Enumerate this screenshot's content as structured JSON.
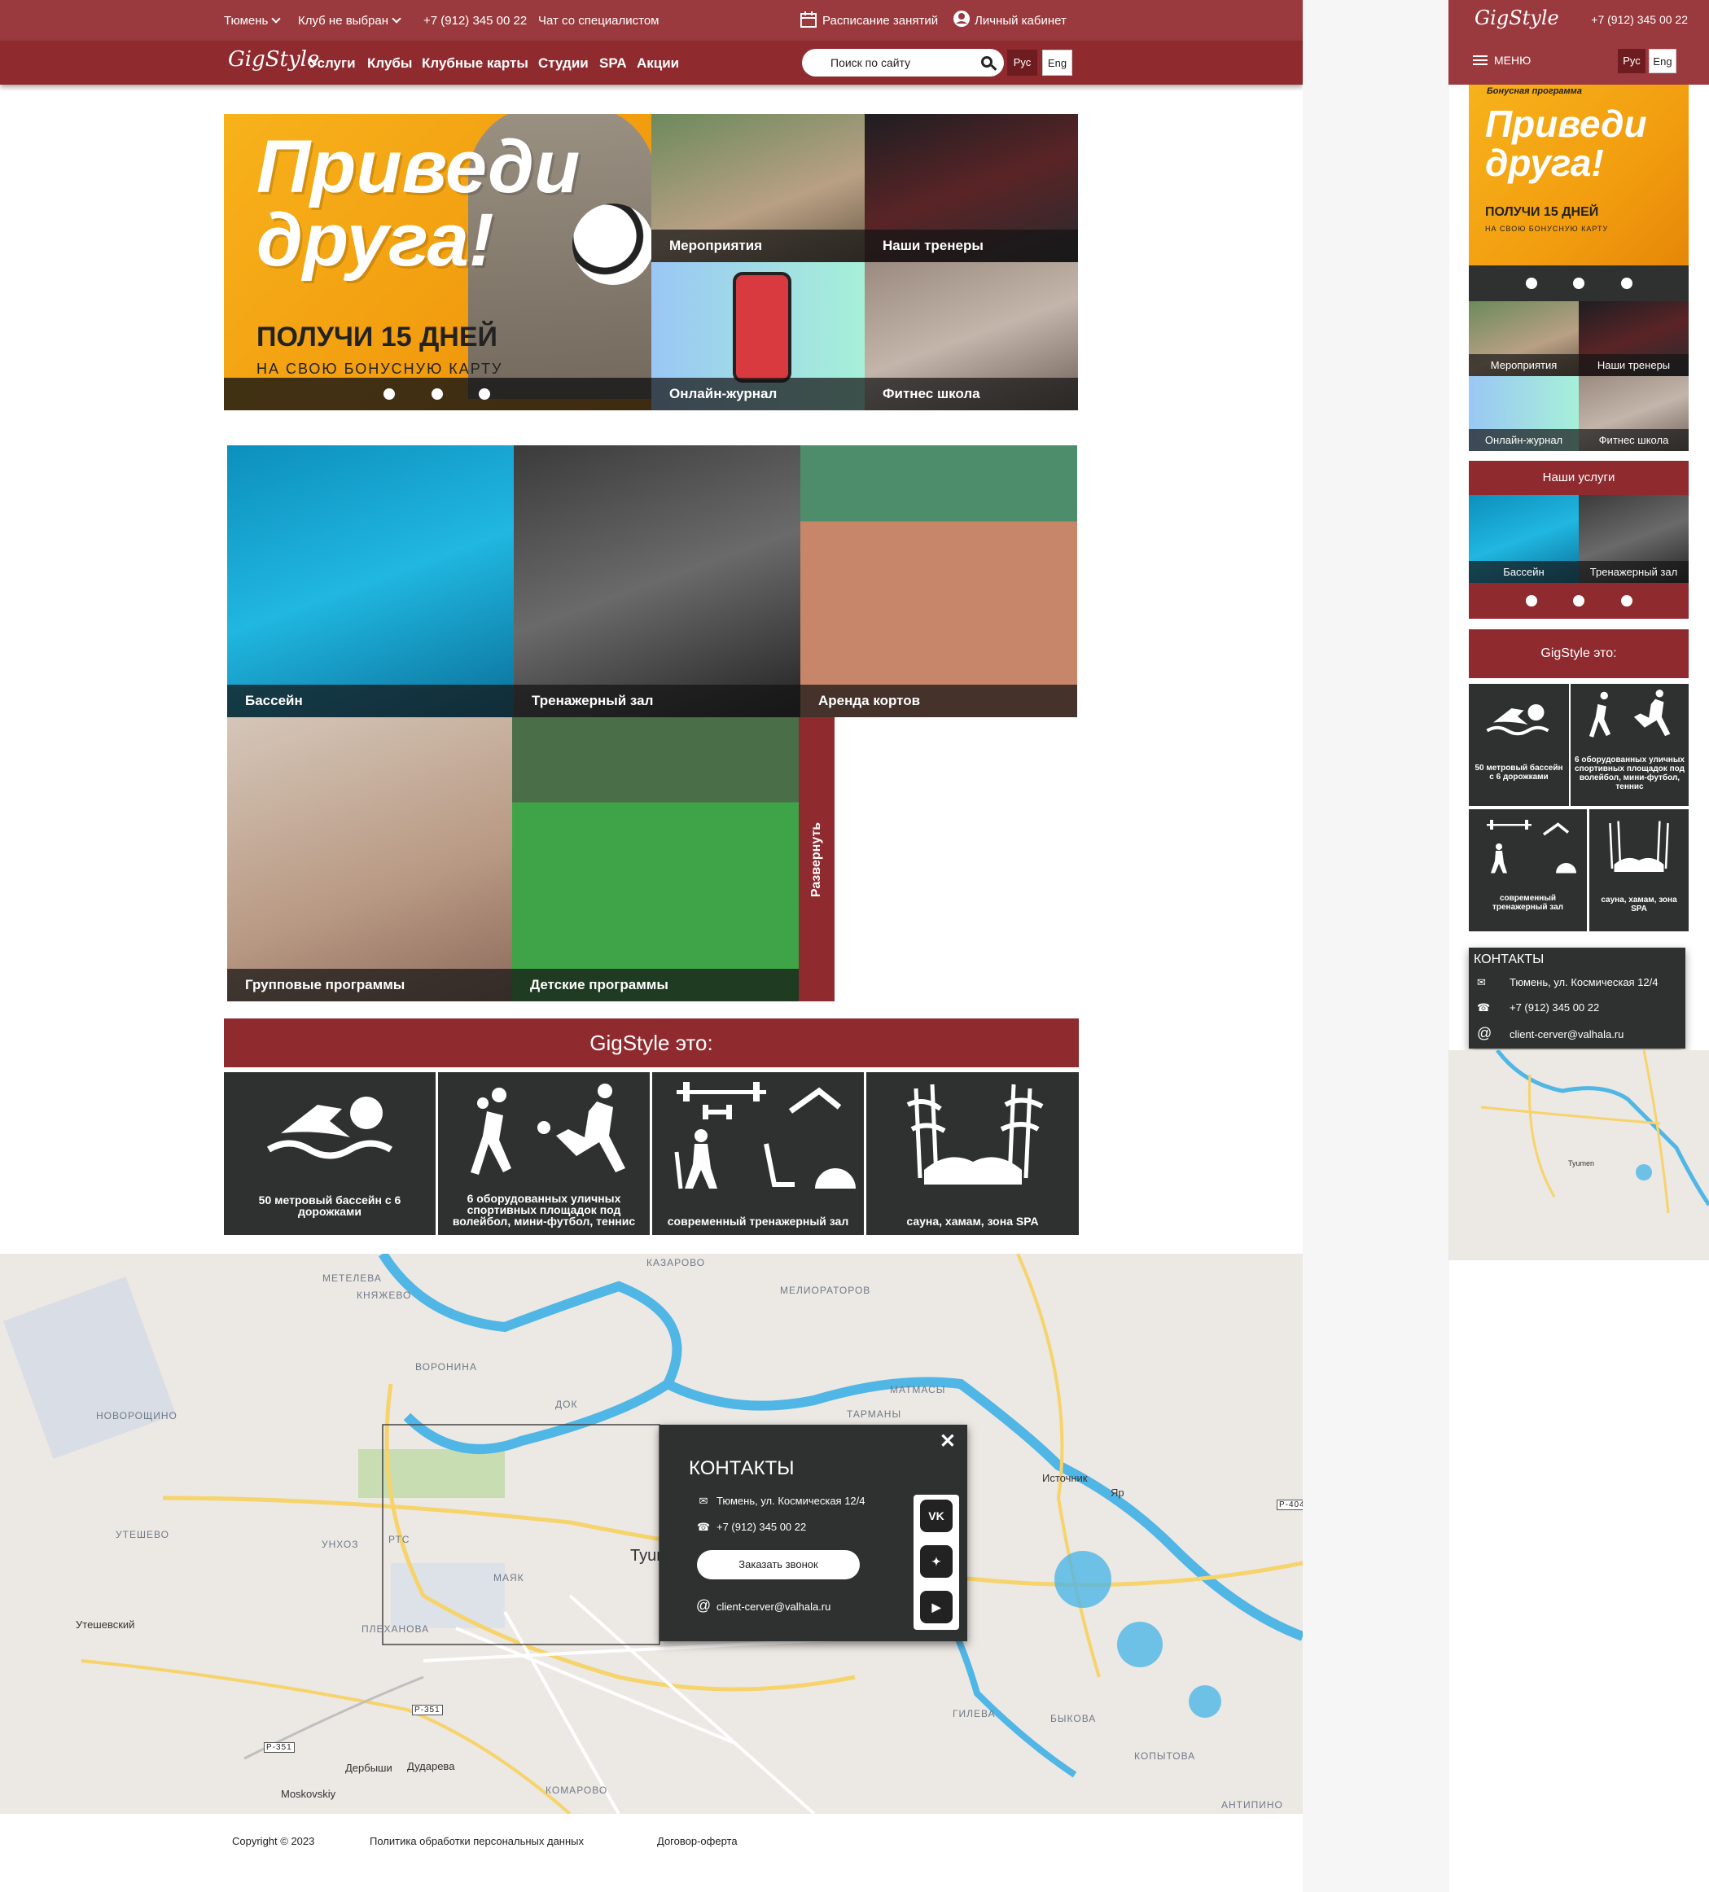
{
  "header": {
    "city": "Тюмень",
    "club": "Клуб не выбран",
    "phone": "+7 (912) 345 00 22",
    "chat": "Чат со специалистом",
    "schedule": "Расписание занятий",
    "cabinet": "Личный кабинет"
  },
  "nav": {
    "logo": "GigStyle",
    "items": [
      "Услуги",
      "Клубы",
      "Клубные карты",
      "Студии",
      "SPA",
      "Акции"
    ],
    "search_placeholder": "Поиск по сайту",
    "lang_ru": "Рус",
    "lang_en": "Eng"
  },
  "hero": {
    "promo_title_1": "Приведи",
    "promo_title_2": "друга!",
    "promo_sub": "ПОЛУЧИ 15 ДНЕЙ",
    "promo_sub2": "НА СВОЮ БОНУСНУЮ КАРТУ",
    "tiles": [
      "Мероприятия",
      "Наши тренеры",
      "Онлайн-журнал",
      "Фитнес школа"
    ]
  },
  "services": {
    "tiles": [
      "Бассейн",
      "Тренажерный зал",
      "Аренда кортов",
      "Групповые программы",
      "Детские программы"
    ],
    "expand": "Развернуть"
  },
  "about": {
    "title": "GigStyle это:",
    "features": [
      "50 метровый бассейн с 6 дорожками",
      "6 оборудованных уличных спортивных площадок под волейбол, мини-футбол, теннис",
      "современный тренажерный зал",
      "сауна, хамам, зона SPA"
    ],
    "icons": [
      "swimmer-icon",
      "volleyball-football-icon",
      "gym-equipment-icon",
      "sauna-bamboo-icon"
    ]
  },
  "map": {
    "labels": [
      "КАЗАРОВО",
      "МЕТЕЛЕВА",
      "КНЯЖЕВО",
      "МЕЛИОРАТОРОВ",
      "ВОРОНИНА",
      "НОВОРОЩИНО",
      "МАТМАСЫ",
      "ДОК",
      "ТАРМАНЫ",
      "УТЕШЕВО",
      "РТС",
      "УНХОЗ",
      "МАЯК",
      "ПЛЕХАНОВА",
      "ГИЛЕВА",
      "БЫКОВА",
      "КОПЫТОВА",
      "КОМАРОВО",
      "АНТИПИНО"
    ],
    "cities": [
      "Tyumen",
      "Источник",
      "Яр",
      "Утешевский",
      "Дербыши",
      "Дударева",
      "Moskovskiy"
    ],
    "roads": [
      "Р-404",
      "Р-351",
      "Р-351"
    ]
  },
  "contacts": {
    "title": "КОНТАКТЫ",
    "address": "Тюмень, ул. Космическая 12/4",
    "phone": "+7 (912) 345 00 22",
    "call_button": "Заказать звонок",
    "email": "client-cerver@valhala.ru",
    "socials": [
      "vk-icon",
      "star-icon",
      "rutube-icon"
    ]
  },
  "footer": {
    "copyright": "Copyright © 2023",
    "privacy": "Политика обработки персональных данных",
    "offer": "Договор-оферта"
  },
  "mobile": {
    "phone": "+7 (912) 345 00 22",
    "menu": "МЕНЮ",
    "promo_label": "Бонусная программа",
    "services_title": "Наши услуги",
    "service_tiles": [
      "Бассейн",
      "Тренажерный зал"
    ],
    "contacts_title": "КОНТАКТЫ",
    "map_city": "Tyumen"
  },
  "colors": {
    "primary": "#8f2a2f",
    "topbar": "#9b3a3e",
    "dark_panel": "#2f3131"
  }
}
